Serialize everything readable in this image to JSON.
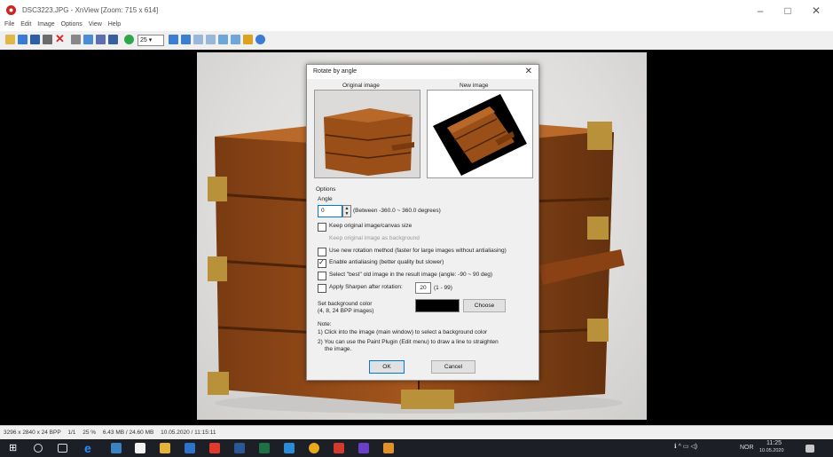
{
  "window": {
    "title": "DSC3223.JPG - XnView [Zoom: 715 x 614]",
    "min": "–",
    "max": "□",
    "close": "✕"
  },
  "menu": [
    "File",
    "Edit",
    "Image",
    "Options",
    "View",
    "Help"
  ],
  "toolbar": {
    "zoom_box": "25 ▾"
  },
  "status": {
    "dims": "3296 x 2840 x 24 BPP",
    "index": "1/1",
    "zoom": "25 %",
    "size": "6.43 MB / 24.60 MB",
    "date": "10.05.2020 / 11:15:11"
  },
  "dialog": {
    "title": "Rotate by angle",
    "close": "✕",
    "original_label": "Original image",
    "new_label": "New image",
    "options_label": "Options",
    "angle_label": "Angle",
    "angle_value": "0",
    "angle_range": "(Between -360.0 ~ 360.0 degrees)",
    "opt_keep_size": "Keep original image/canvas size",
    "opt_background": "Keep original image as background",
    "opt_new_method": "Use new rotation method (faster for large images without antialiasing)",
    "opt_antialias": "Enable antialiasing (better quality but slower)",
    "opt_best_old": "Select \"best\" old image in the result image (angle: -90 ~ 90 deg)",
    "opt_sharpen": "Apply Sharpen after rotation:",
    "sharpen_value": "20",
    "sharpen_range": "(1 - 99)",
    "bg_color_label": "Set background color",
    "bg_color_sub": "(4, 8, 24 BPP images)",
    "bg_color_value": "#000000",
    "choose": "Choose",
    "note_title": "Note:",
    "note1": "1) Click into the image (main window) to select a background color",
    "note2": "2) You can use the Paint Plugin (Edit menu) to draw a line to straighten",
    "note3": "the image.",
    "ok": "OK",
    "cancel": "Cancel"
  },
  "tray": {
    "time": "11:25",
    "date": "10.05.2020",
    "lang": "NOR"
  }
}
